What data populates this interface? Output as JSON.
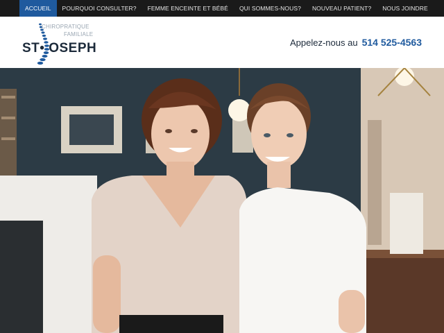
{
  "nav": {
    "items": [
      {
        "label": "ACCUEIL",
        "active": true
      },
      {
        "label": "POURQUOI CONSULTER?"
      },
      {
        "label": "FEMME ENCEINTE ET BÉBÉ"
      },
      {
        "label": "QUI SOMMES-NOUS?"
      },
      {
        "label": "NOUVEAU PATIENT?"
      },
      {
        "label": "NOUS JOINDRE"
      }
    ],
    "active_color": "#1f5a9e"
  },
  "header": {
    "logo": {
      "tagline_1": "CHIROPRATIQUE",
      "tagline_2": "FAMILIALE",
      "brand": "ST• OSEPH",
      "icon": "spine-icon"
    },
    "phone_label": "Appelez-nous au",
    "phone_number": "514 525-4563"
  },
  "hero": {
    "photo": "two-smiling-women-in-clinic-photo"
  }
}
